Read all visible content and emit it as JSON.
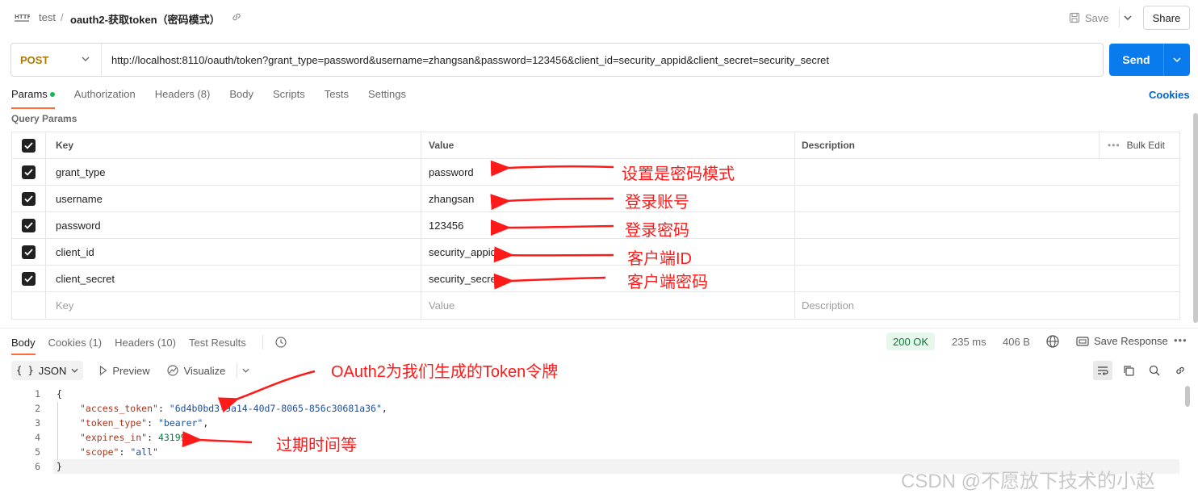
{
  "header": {
    "collection": "test",
    "separator": "/",
    "request_name": "oauth2-获取token（密码模式）",
    "save_label": "Save",
    "share_label": "Share"
  },
  "request": {
    "method": "POST",
    "url": "http://localhost:8110/oauth/token?grant_type=password&username=zhangsan&password=123456&client_id=security_appid&client_secret=security_secret",
    "send_label": "Send"
  },
  "tabs": [
    "Params",
    "Authorization",
    "Headers (8)",
    "Body",
    "Scripts",
    "Tests",
    "Settings"
  ],
  "cookies_label": "Cookies",
  "query_params": {
    "title": "Query Params",
    "columns": {
      "key": "Key",
      "value": "Value",
      "description": "Description"
    },
    "bulk_edit": "Bulk Edit",
    "rows": [
      {
        "key": "grant_type",
        "value": "password"
      },
      {
        "key": "username",
        "value": "zhangsan"
      },
      {
        "key": "password",
        "value": "123456"
      },
      {
        "key": "client_id",
        "value": "security_appid"
      },
      {
        "key": "client_secret",
        "value": "security_secret"
      }
    ],
    "placeholders": {
      "key": "Key",
      "value": "Value",
      "description": "Description"
    }
  },
  "response": {
    "tabs": [
      "Body",
      "Cookies (1)",
      "Headers (10)",
      "Test Results"
    ],
    "status": "200 OK",
    "time": "235 ms",
    "size": "406 B",
    "save_response": "Save Response",
    "format": "JSON",
    "preview": "Preview",
    "visualize": "Visualize",
    "line_numbers": [
      "1",
      "2",
      "3",
      "4",
      "5",
      "6"
    ],
    "body": {
      "open": "{",
      "access_token_key": "\"access_token\"",
      "access_token_value": "\"6d4b0bd3-9a14-40d7-8065-856c30681a36\"",
      "token_type_key": "\"token_type\"",
      "token_type_value": "\"bearer\"",
      "expires_in_key": "\"expires_in\"",
      "expires_in_value": "43199",
      "scope_key": "\"scope\"",
      "scope_value": "\"all\"",
      "close": "}"
    }
  },
  "annotations": {
    "grant_type": "设置是密码模式",
    "username": "登录账号",
    "password": "登录密码",
    "client_id": "客户端ID",
    "client_secret": "客户端密码",
    "token": "OAuth2为我们生成的Token令牌",
    "expires": "过期时间等"
  },
  "watermark": "CSDN @不愿放下技术的小赵",
  "colors": {
    "send": "#097bed",
    "method": "#ad7a03",
    "tab_indicator": "#ff6c37",
    "status_ok": "#067a39",
    "annotation": "#ff1a1a"
  }
}
